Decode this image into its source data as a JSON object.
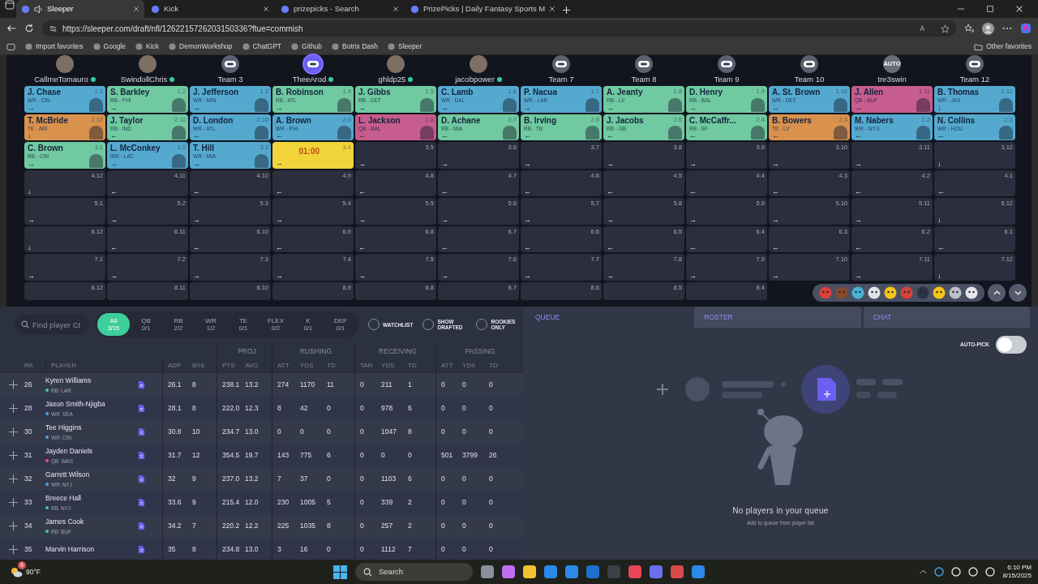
{
  "browser": {
    "tabs": [
      {
        "title": "Sleeper",
        "selected": true,
        "audio": true
      },
      {
        "title": "Kick",
        "selected": false,
        "audio": false
      },
      {
        "title": "prizepicks - Search",
        "selected": false,
        "audio": false
      },
      {
        "title": "PrizePicks | Daily Fantasy Sports M",
        "selected": false,
        "audio": false
      }
    ],
    "url": "https://sleeper.com/draft/nfl/1262215726203150336?ftue=commish",
    "bookmarks": [
      {
        "label": "Import favorites"
      },
      {
        "label": "Google"
      },
      {
        "label": "Kick"
      },
      {
        "label": "DemonWorkshop"
      },
      {
        "label": "ChatGPT"
      },
      {
        "label": "Github"
      },
      {
        "label": "Botrix Dash"
      },
      {
        "label": "Sleeper"
      }
    ],
    "other_favorites": "Other favorites"
  },
  "draft_board": {
    "teams": [
      {
        "name": "CallmeTomauro",
        "kind": "photo",
        "online": true,
        "on_clock": false
      },
      {
        "name": "SwindollChris",
        "kind": "photo",
        "online": true,
        "on_clock": false
      },
      {
        "name": "Team 3",
        "kind": "robot",
        "online": false,
        "on_clock": false
      },
      {
        "name": "TheeArod",
        "kind": "robot",
        "online": true,
        "on_clock": true
      },
      {
        "name": "ghldp25",
        "kind": "photo",
        "online": true,
        "on_clock": false
      },
      {
        "name": "jacobpower",
        "kind": "photo",
        "online": true,
        "on_clock": false
      },
      {
        "name": "Team 7",
        "kind": "robot",
        "online": false,
        "on_clock": false
      },
      {
        "name": "Team 8",
        "kind": "robot",
        "online": false,
        "on_clock": false
      },
      {
        "name": "Team 9",
        "kind": "robot",
        "online": false,
        "on_clock": false
      },
      {
        "name": "Team 10",
        "kind": "robot",
        "online": false,
        "on_clock": false
      },
      {
        "name": "tre3swin",
        "kind": "auto",
        "avatar_text": "AUTO",
        "online": false,
        "on_clock": false
      },
      {
        "name": "Team 12",
        "kind": "robot",
        "online": false,
        "on_clock": false
      }
    ],
    "rounds": [
      {
        "picks": [
          {
            "kind": "player",
            "pick": "1.1",
            "player": "J. Chase",
            "info": "WR - CIN",
            "color": "#55a9cf",
            "arrow": "→"
          },
          {
            "kind": "player",
            "pick": "1.2",
            "player": "S. Barkley",
            "info": "RB - PHI",
            "color": "#70c9a0",
            "arrow": "→"
          },
          {
            "kind": "player",
            "pick": "1.3",
            "player": "J. Jefferson",
            "info": "WR - MIN",
            "color": "#55a9cf",
            "arrow": "→"
          },
          {
            "kind": "player",
            "pick": "1.4",
            "player": "B. Robinson",
            "info": "RB - ATL",
            "color": "#70c9a0",
            "arrow": "→"
          },
          {
            "kind": "player",
            "pick": "1.5",
            "player": "J. Gibbs",
            "info": "RB - DET",
            "color": "#70c9a0",
            "arrow": "→"
          },
          {
            "kind": "player",
            "pick": "1.6",
            "player": "C. Lamb",
            "info": "WR - DAL",
            "color": "#55a9cf",
            "arrow": "→"
          },
          {
            "kind": "player",
            "pick": "1.7",
            "player": "P. Nacua",
            "info": "WR - LAR",
            "color": "#55a9cf",
            "arrow": "→"
          },
          {
            "kind": "player",
            "pick": "1.8",
            "player": "A. Jeanty",
            "info": "RB - LV",
            "color": "#70c9a0",
            "arrow": "→"
          },
          {
            "kind": "player",
            "pick": "1.9",
            "player": "D. Henry",
            "info": "RB - BAL",
            "color": "#70c9a0",
            "arrow": "→"
          },
          {
            "kind": "player",
            "pick": "1.10",
            "player": "A. St. Brown",
            "info": "WR - DET",
            "color": "#55a9cf",
            "arrow": "→"
          },
          {
            "kind": "player",
            "pick": "1.11",
            "player": "J. Allen",
            "info": "QB - BUF",
            "color": "#c75c8e",
            "arrow": "→"
          },
          {
            "kind": "player",
            "pick": "1.12",
            "player": "B. Thomas",
            "info": "WR - JAX",
            "color": "#55a9cf",
            "arrow": "↓"
          }
        ]
      },
      {
        "picks": [
          {
            "kind": "player",
            "pick": "2.12",
            "player": "T. McBride",
            "info": "TE - ARI",
            "color": "#d9914e",
            "arrow": "↓"
          },
          {
            "kind": "player",
            "pick": "2.11",
            "player": "J. Taylor",
            "info": "RB - IND",
            "color": "#70c9a0",
            "arrow": "←"
          },
          {
            "kind": "player",
            "pick": "2.10",
            "player": "D. London",
            "info": "WR - ATL",
            "color": "#55a9cf",
            "arrow": "←"
          },
          {
            "kind": "player",
            "pick": "2.9",
            "player": "A. Brown",
            "info": "WR - PHI",
            "color": "#55a9cf",
            "arrow": "←"
          },
          {
            "kind": "player",
            "pick": "2.8",
            "player": "L. Jackson",
            "info": "QB - BAL",
            "color": "#c75c8e",
            "arrow": "←"
          },
          {
            "kind": "player",
            "pick": "2.7",
            "player": "D. Achane",
            "info": "RB - MIA",
            "color": "#70c9a0",
            "arrow": "←"
          },
          {
            "kind": "player",
            "pick": "2.6",
            "player": "B. Irving",
            "info": "RB - TB",
            "color": "#70c9a0",
            "arrow": "←"
          },
          {
            "kind": "player",
            "pick": "2.5",
            "player": "J. Jacobs",
            "info": "RB - GB",
            "color": "#70c9a0",
            "arrow": "←"
          },
          {
            "kind": "player",
            "pick": "2.4",
            "player": "C. McCaffr...",
            "info": "RB - SF",
            "color": "#70c9a0",
            "arrow": "←"
          },
          {
            "kind": "player",
            "pick": "2.3",
            "player": "B. Bowers",
            "info": "TE - LV",
            "color": "#d9914e",
            "arrow": "←"
          },
          {
            "kind": "player",
            "pick": "2.2",
            "player": "M. Nabers",
            "info": "WR - NYG",
            "color": "#55a9cf",
            "arrow": "←"
          },
          {
            "kind": "player",
            "pick": "2.1",
            "player": "N. Collins",
            "info": "WR - HOU",
            "color": "#55a9cf",
            "arrow": "←"
          }
        ]
      },
      {
        "picks": [
          {
            "kind": "player",
            "pick": "3.1",
            "player": "C. Brown",
            "info": "RB - CIN",
            "color": "#70c9a0",
            "arrow": "→"
          },
          {
            "kind": "player",
            "pick": "3.2",
            "player": "L. McConkey",
            "info": "WR - LAC",
            "color": "#55a9cf",
            "arrow": "→"
          },
          {
            "kind": "player",
            "pick": "3.3",
            "player": "T. Hill",
            "info": "WR - MIA",
            "color": "#55a9cf",
            "arrow": "→"
          },
          {
            "kind": "clock",
            "pick": "3.4",
            "timer": "01:00",
            "arrow": "→"
          },
          {
            "kind": "empty",
            "pick": "3.5",
            "arrow": "→"
          },
          {
            "kind": "empty",
            "pick": "3.6",
            "arrow": "→"
          },
          {
            "kind": "empty",
            "pick": "3.7",
            "arrow": "→"
          },
          {
            "kind": "empty",
            "pick": "3.8",
            "arrow": "→"
          },
          {
            "kind": "empty",
            "pick": "3.9",
            "arrow": "→"
          },
          {
            "kind": "empty",
            "pick": "3.10",
            "arrow": "→"
          },
          {
            "kind": "empty",
            "pick": "3.11",
            "arrow": "→"
          },
          {
            "kind": "empty",
            "pick": "3.12",
            "arrow": "↓"
          }
        ]
      },
      {
        "picks": [
          {
            "kind": "empty",
            "pick": "4.12",
            "arrow": "↓"
          },
          {
            "kind": "empty",
            "pick": "4.11",
            "arrow": "←"
          },
          {
            "kind": "empty",
            "pick": "4.10",
            "arrow": "←"
          },
          {
            "kind": "empty",
            "pick": "4.9",
            "arrow": "←"
          },
          {
            "kind": "empty",
            "pick": "4.8",
            "arrow": "←"
          },
          {
            "kind": "empty",
            "pick": "4.7",
            "arrow": "←"
          },
          {
            "kind": "empty",
            "pick": "4.6",
            "arrow": "←"
          },
          {
            "kind": "empty",
            "pick": "4.5",
            "arrow": "←"
          },
          {
            "kind": "empty",
            "pick": "4.4",
            "arrow": "←"
          },
          {
            "kind": "empty",
            "pick": "4.3",
            "arrow": "←"
          },
          {
            "kind": "empty",
            "pick": "4.2",
            "arrow": "←"
          },
          {
            "kind": "empty",
            "pick": "4.1",
            "arrow": "←"
          }
        ]
      },
      {
        "picks": [
          {
            "kind": "empty",
            "pick": "5.1",
            "arrow": "→"
          },
          {
            "kind": "empty",
            "pick": "5.2",
            "arrow": "→"
          },
          {
            "kind": "empty",
            "pick": "5.3",
            "arrow": "→"
          },
          {
            "kind": "empty",
            "pick": "5.4",
            "arrow": "→"
          },
          {
            "kind": "empty",
            "pick": "5.5",
            "arrow": "→"
          },
          {
            "kind": "empty",
            "pick": "5.6",
            "arrow": "→"
          },
          {
            "kind": "empty",
            "pick": "5.7",
            "arrow": "→"
          },
          {
            "kind": "empty",
            "pick": "5.8",
            "arrow": "→"
          },
          {
            "kind": "empty",
            "pick": "5.9",
            "arrow": "→"
          },
          {
            "kind": "empty",
            "pick": "5.10",
            "arrow": "→"
          },
          {
            "kind": "empty",
            "pick": "5.11",
            "arrow": "→"
          },
          {
            "kind": "empty",
            "pick": "5.12",
            "arrow": "↓"
          }
        ]
      },
      {
        "picks": [
          {
            "kind": "empty",
            "pick": "6.12",
            "arrow": "↓"
          },
          {
            "kind": "empty",
            "pick": "6.11",
            "arrow": "←"
          },
          {
            "kind": "empty",
            "pick": "6.10",
            "arrow": "←"
          },
          {
            "kind": "empty",
            "pick": "6.9",
            "arrow": "←"
          },
          {
            "kind": "empty",
            "pick": "6.8",
            "arrow": "←"
          },
          {
            "kind": "empty",
            "pick": "6.7",
            "arrow": "←"
          },
          {
            "kind": "empty",
            "pick": "6.6",
            "arrow": "←"
          },
          {
            "kind": "empty",
            "pick": "6.5",
            "arrow": "←"
          },
          {
            "kind": "empty",
            "pick": "6.4",
            "arrow": "←"
          },
          {
            "kind": "empty",
            "pick": "6.3",
            "arrow": "←"
          },
          {
            "kind": "empty",
            "pick": "6.2",
            "arrow": "←"
          },
          {
            "kind": "empty",
            "pick": "6.1",
            "arrow": "←"
          }
        ]
      },
      {
        "picks": [
          {
            "kind": "empty",
            "pick": "7.1",
            "arrow": "→"
          },
          {
            "kind": "empty",
            "pick": "7.2",
            "arrow": "→"
          },
          {
            "kind": "empty",
            "pick": "7.3",
            "arrow": "→"
          },
          {
            "kind": "empty",
            "pick": "7.4",
            "arrow": "→"
          },
          {
            "kind": "empty",
            "pick": "7.5",
            "arrow": "→"
          },
          {
            "kind": "empty",
            "pick": "7.6",
            "arrow": "→"
          },
          {
            "kind": "empty",
            "pick": "7.7",
            "arrow": "→"
          },
          {
            "kind": "empty",
            "pick": "7.8",
            "arrow": "→"
          },
          {
            "kind": "empty",
            "pick": "7.9",
            "arrow": "→"
          },
          {
            "kind": "empty",
            "pick": "7.10",
            "arrow": "→"
          },
          {
            "kind": "empty",
            "pick": "7.11",
            "arrow": "→"
          },
          {
            "kind": "empty",
            "pick": "7.12",
            "arrow": "↓"
          }
        ]
      },
      {
        "picks": [
          {
            "kind": "empty",
            "pick": "8.12"
          },
          {
            "kind": "empty",
            "pick": "8.11"
          },
          {
            "kind": "empty",
            "pick": "8.10"
          },
          {
            "kind": "empty",
            "pick": "8.9"
          },
          {
            "kind": "empty",
            "pick": "8.8"
          },
          {
            "kind": "empty",
            "pick": "8.7"
          },
          {
            "kind": "empty",
            "pick": "8.6"
          },
          {
            "kind": "empty",
            "pick": "8.5"
          },
          {
            "kind": "empty",
            "pick": "8.4"
          }
        ]
      }
    ]
  },
  "player_list": {
    "search_placeholder": "Find player Ct",
    "filters": [
      {
        "label": "All",
        "count": "3/15",
        "selected": true
      },
      {
        "label": "QB",
        "count": "0/1",
        "selected": false
      },
      {
        "label": "RB",
        "count": "2/2",
        "selected": false
      },
      {
        "label": "WR",
        "count": "1/2",
        "selected": false
      },
      {
        "label": "TE",
        "count": "0/1",
        "selected": false
      },
      {
        "label": "FLEX",
        "count": "0/2",
        "selected": false
      },
      {
        "label": "K",
        "count": "0/1",
        "selected": false
      },
      {
        "label": "DEF",
        "count": "0/1",
        "selected": false
      }
    ],
    "toggles": [
      {
        "label": "WATCHLIST",
        "checked": false
      },
      {
        "label": "SHOW DRAFTED",
        "checked": false
      },
      {
        "label": "ROOKIES ONLY",
        "checked": false
      }
    ],
    "columns_lead": [
      "RK",
      "PLAYER",
      "ADP",
      "BYE"
    ],
    "column_groups": [
      {
        "label": "PROJ",
        "columns": [
          "PTS",
          "AVG"
        ]
      },
      {
        "label": "RUSHING",
        "columns": [
          "ATT",
          "YDS",
          "TD"
        ]
      },
      {
        "label": "RECEIVING",
        "columns": [
          "TAR",
          "YDS",
          "TD"
        ]
      },
      {
        "label": "PASSING",
        "columns": [
          "ATT",
          "YDS",
          "TD"
        ]
      }
    ],
    "rows": [
      {
        "rk": "26",
        "name": "Kyren Williams",
        "pos": "RB",
        "team": "LAR",
        "color": "#3ecf8e",
        "stats": [
          "26.1",
          "8",
          "238.1",
          "13.2",
          "274",
          "1170",
          "11",
          "0",
          "211",
          "1",
          "0",
          "0",
          "0"
        ]
      },
      {
        "rk": "28",
        "name": "Jaxon Smith-Njigba",
        "pos": "WR",
        "team": "SEA",
        "color": "#4aa8e0",
        "stats": [
          "28.1",
          "8",
          "222.0",
          "12.3",
          "8",
          "42",
          "0",
          "0",
          "978",
          "6",
          "0",
          "0",
          "0"
        ]
      },
      {
        "rk": "30",
        "name": "Tee Higgins",
        "pos": "WR",
        "team": "CIN",
        "color": "#4aa8e0",
        "stats": [
          "30.8",
          "10",
          "234.7",
          "13.0",
          "0",
          "0",
          "0",
          "0",
          "1047",
          "8",
          "0",
          "0",
          "0"
        ]
      },
      {
        "rk": "31",
        "name": "Jayden Daniels",
        "pos": "QB",
        "team": "WAS",
        "color": "#e0507f",
        "stats": [
          "31.7",
          "12",
          "354.5",
          "19.7",
          "143",
          "775",
          "6",
          "0",
          "0",
          "0",
          "501",
          "3799",
          "26"
        ]
      },
      {
        "rk": "32",
        "name": "Garrett Wilson",
        "pos": "WR",
        "team": "NYJ",
        "color": "#4aa8e0",
        "stats": [
          "32",
          "9",
          "237.0",
          "13.2",
          "7",
          "37",
          "0",
          "0",
          "1103",
          "6",
          "0",
          "0",
          "0"
        ]
      },
      {
        "rk": "33",
        "name": "Breece Hall",
        "pos": "RB",
        "team": "NYJ",
        "color": "#3ecf8e",
        "stats": [
          "33.6",
          "9",
          "215.4",
          "12.0",
          "230",
          "1005",
          "5",
          "0",
          "339",
          "2",
          "0",
          "0",
          "0"
        ]
      },
      {
        "rk": "34",
        "name": "James Cook",
        "pos": "RB",
        "team": "BUF",
        "color": "#3ecf8e",
        "stats": [
          "34.2",
          "7",
          "220.2",
          "12.2",
          "225",
          "1035",
          "8",
          "0",
          "257",
          "2",
          "0",
          "0",
          "0"
        ]
      },
      {
        "rk": "35",
        "name": "Marvin Harrison",
        "stats": [
          "35",
          "8",
          "234.8",
          "13.0",
          "3",
          "16",
          "0",
          "0",
          "1112",
          "7",
          "0",
          "0",
          "0"
        ]
      }
    ]
  },
  "side_panel": {
    "tabs": [
      {
        "label": "QUEUE",
        "selected": true
      },
      {
        "label": "ROSTER",
        "selected": false
      },
      {
        "label": "CHAT",
        "selected": false
      }
    ],
    "auto_pick": {
      "label": "AUTO-PICK",
      "on": false
    },
    "empty_title": "No players in your queue",
    "empty_hint": "Add to queue from player list"
  },
  "taskbar": {
    "weather": "90°F",
    "weather_badge": "6",
    "search": "Search",
    "time": "6:10 PM",
    "date": "8/15/2025"
  }
}
